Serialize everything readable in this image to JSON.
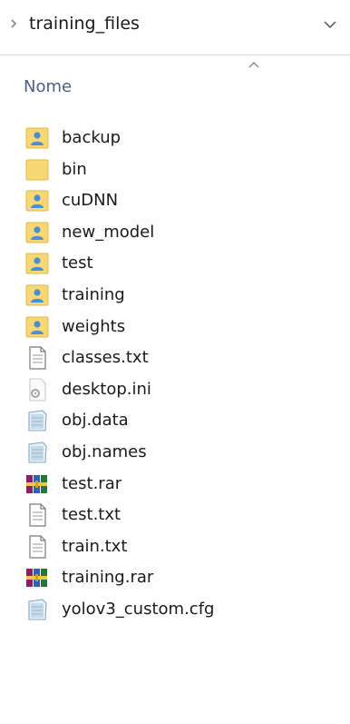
{
  "address": {
    "folder": "training_files",
    "chevron_icon": "chevron-right-icon",
    "dropdown_icon": "chevron-down-icon"
  },
  "column": {
    "name_header": "Nome",
    "sort_icon": "sort-ascending-icon"
  },
  "files": [
    {
      "name": "backup",
      "type": "folder-user"
    },
    {
      "name": "bin",
      "type": "folder"
    },
    {
      "name": "cuDNN",
      "type": "folder-user"
    },
    {
      "name": "new_model",
      "type": "folder-user"
    },
    {
      "name": "test",
      "type": "folder-user"
    },
    {
      "name": "training",
      "type": "folder-user"
    },
    {
      "name": "weights",
      "type": "folder-user"
    },
    {
      "name": "classes.txt",
      "type": "text"
    },
    {
      "name": "desktop.ini",
      "type": "settings"
    },
    {
      "name": "obj.data",
      "type": "generic"
    },
    {
      "name": "obj.names",
      "type": "generic"
    },
    {
      "name": "test.rar",
      "type": "archive"
    },
    {
      "name": "test.txt",
      "type": "text"
    },
    {
      "name": "train.txt",
      "type": "text"
    },
    {
      "name": "training.rar",
      "type": "archive"
    },
    {
      "name": "yolov3_custom.cfg",
      "type": "generic"
    }
  ],
  "colors": {
    "folder": "#f8d775",
    "folder_edge": "#e0b94a",
    "user_badge": "#4a8fd6",
    "header_text": "#4d6082"
  }
}
